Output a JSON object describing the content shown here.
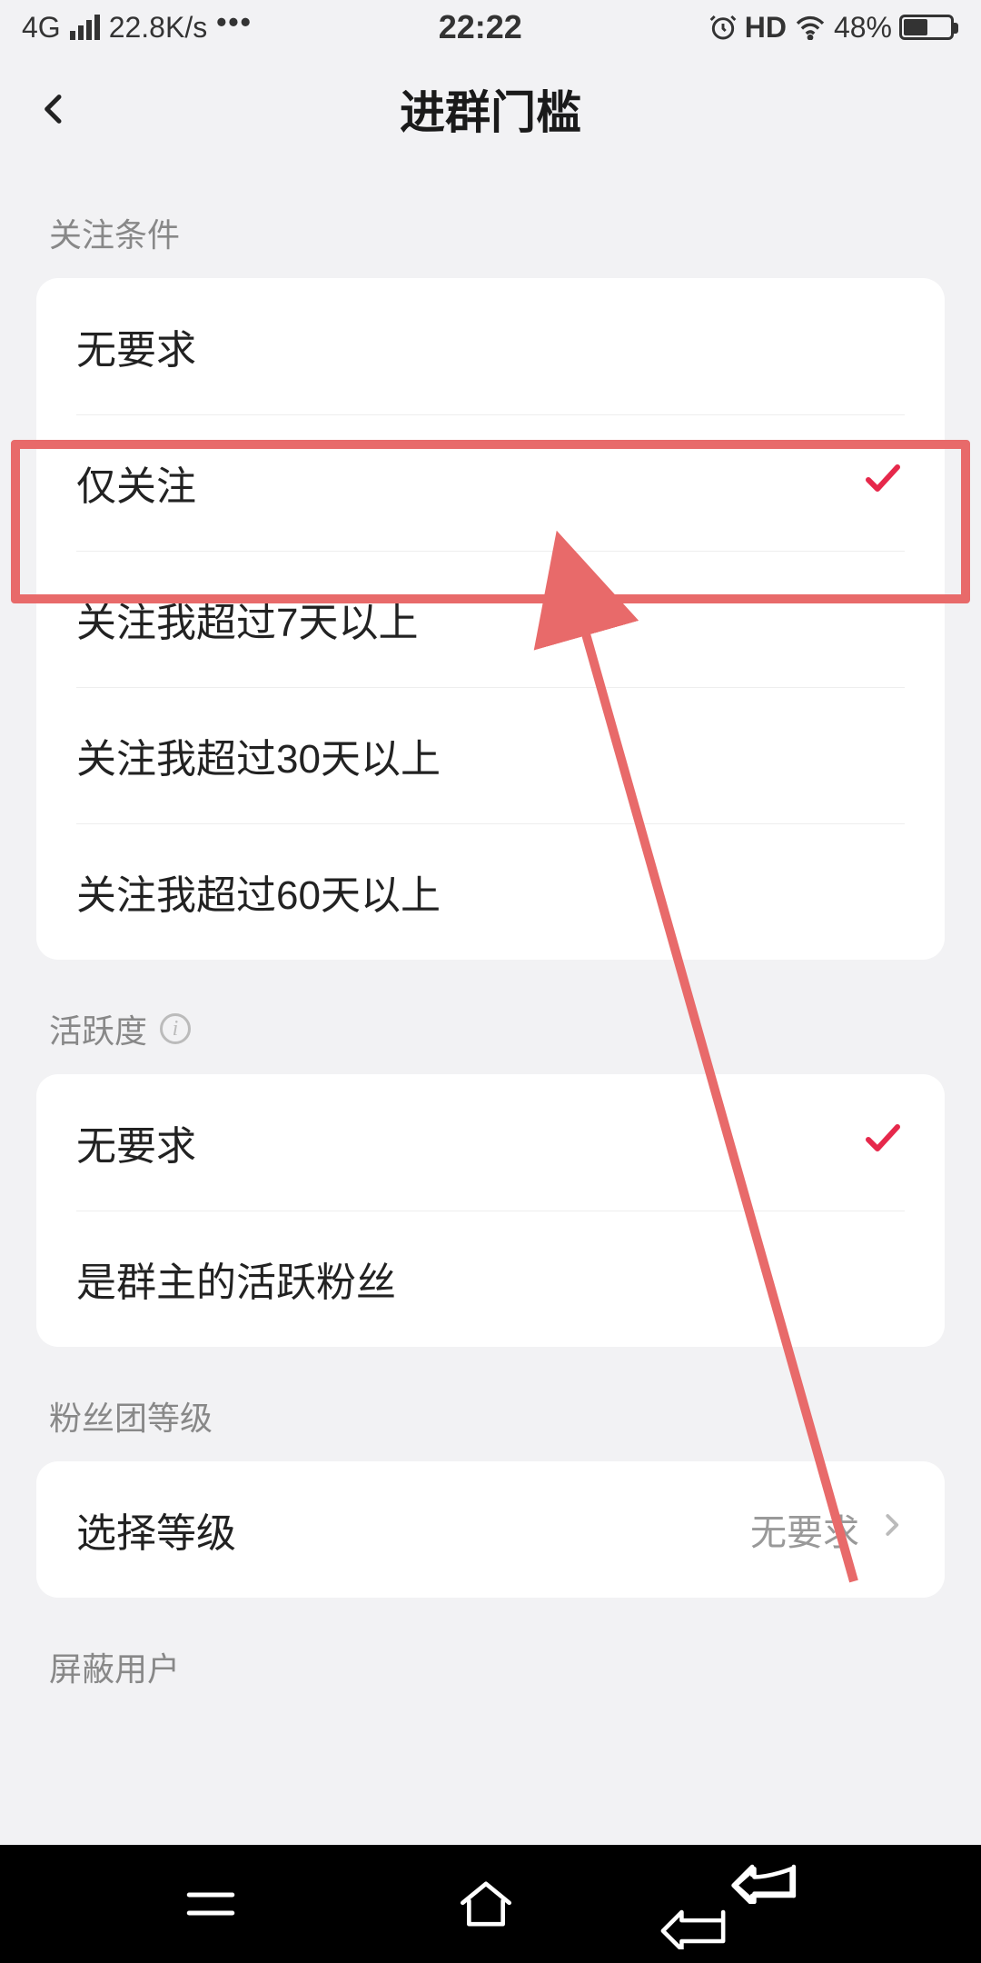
{
  "status": {
    "network_type": "4G",
    "speed": "22.8K/s",
    "hd_label": "HD",
    "time": "22:22",
    "battery_pct": "48%"
  },
  "nav": {
    "title": "进群门槛"
  },
  "sections": {
    "follow": {
      "header": "关注条件",
      "options": [
        {
          "label": "无要求",
          "selected": false
        },
        {
          "label": "仅关注",
          "selected": true
        },
        {
          "label": "关注我超过7天以上",
          "selected": false
        },
        {
          "label": "关注我超过30天以上",
          "selected": false
        },
        {
          "label": "关注我超过60天以上",
          "selected": false
        }
      ]
    },
    "activity": {
      "header": "活跃度",
      "options": [
        {
          "label": "无要求",
          "selected": true
        },
        {
          "label": "是群主的活跃粉丝",
          "selected": false
        }
      ]
    },
    "fan_level": {
      "header": "粉丝团等级",
      "row_label": "选择等级",
      "row_value": "无要求"
    },
    "blocked": {
      "header": "屏蔽用户"
    }
  }
}
